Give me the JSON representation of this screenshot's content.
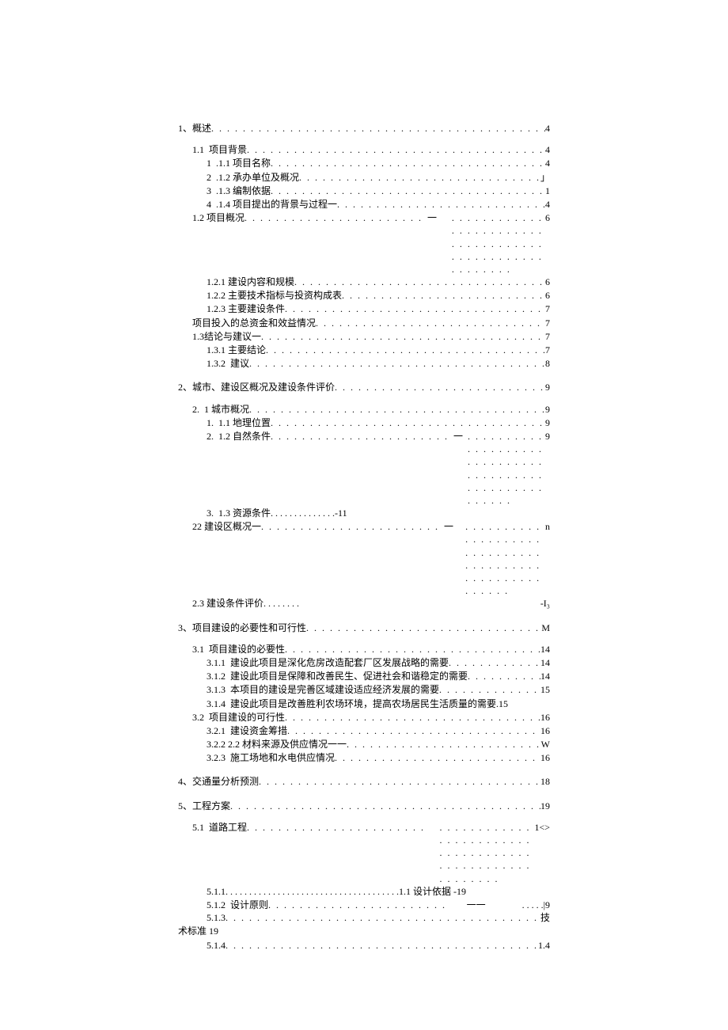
{
  "toc": {
    "c1": {
      "num": "1、",
      "title": "概述",
      "page": "4",
      "s11": {
        "num": "1.1",
        "title": "项目背景",
        "page": "4"
      },
      "s111": {
        "num": "1",
        "title": ".1.1 项目名称",
        "page": "4"
      },
      "s112": {
        "num": "2",
        "title": ".1.2 承办单位及概况",
        "page": "」"
      },
      "s113": {
        "num": "3",
        "title": ".1.3 编制依据",
        "page": "1"
      },
      "s114": {
        "num": "4",
        "title": ".1.4 项目提出的背景与过程一",
        "page": "4"
      },
      "s12": {
        "num": "1.2",
        "title": "项目概况",
        "mid": "一",
        "page": "6"
      },
      "s121": {
        "num": "1.2.1",
        "title": "建设内容和规模",
        "page": "6"
      },
      "s122": {
        "num": "1.2.2",
        "title": "主要技术指标与投资构成表",
        "page": "6"
      },
      "s123": {
        "num": "1.2.3",
        "title": "主要建设条件",
        "page": "7"
      },
      "sInvest": {
        "title": "项目投入的总资金和效益情况",
        "page": "7"
      },
      "s13": {
        "num": "1.3",
        "title": "结论与建议一",
        "page": "7"
      },
      "s131": {
        "num": "1.3.1",
        "title": "主要结论",
        "page": "7"
      },
      "s132": {
        "num": "1.3.2",
        "title": "建议",
        "page": "8"
      }
    },
    "c2": {
      "num": "2、",
      "title": "城市、建设区概况及建设条件评价",
      "page": "9",
      "s21": {
        "num": "2.",
        "title": "1 城市概况",
        "page": "9"
      },
      "s211": {
        "num": "1.",
        "title": "1.1 地理位置",
        "page": "9"
      },
      "s212": {
        "num": "2.",
        "title": "1.2 自然条件",
        "mid": "一",
        "page": "9"
      },
      "s213": {
        "num": "3.",
        "title": "1.3 资源条件",
        "page": "-11"
      },
      "s22": {
        "title": "22 建设区概况一",
        "mid": "一",
        "page": "n"
      },
      "s23": {
        "title": "2.3 建设条件评价",
        "page": "-I₃"
      }
    },
    "c3": {
      "num": "3、",
      "title": "项目建设的必要性和可行性",
      "page": "M",
      "s31": {
        "num": "3.1",
        "title": "项目建设的必要性",
        "page": "14"
      },
      "s311": {
        "num": "3.1.1",
        "title": "建设此项目是深化危房改造配套厂区发展战略的需要",
        "page": "14"
      },
      "s312": {
        "num": "3.1.2",
        "title": "建设此项目是保障和改善民生、促进社会和谐稳定的需要",
        "page": "14"
      },
      "s313": {
        "num": "3.1.3",
        "title": "本项目的建设是完善区域建设适应经济发展的需要",
        "page": "15"
      },
      "s314": {
        "num": "3.1.4",
        "title": "建设此项目是改善胜利农场环境，提高农场居民生活质量的需要",
        "page": "15"
      },
      "s32": {
        "num": "3.2",
        "title": "项目建设的可行性",
        "page": "16"
      },
      "s321": {
        "num": "3.2.1",
        "title": "建设资金筹措",
        "page": "16"
      },
      "s322": {
        "num": "3.2.2 2.2 材料来源及供应情况一一",
        "title": "",
        "page": "W"
      },
      "s323": {
        "num": "3.2.3",
        "title": "施工场地和水电供应情况",
        "page": "16"
      }
    },
    "c4": {
      "num": "4、",
      "title": "交通量分析预测",
      "page": "18"
    },
    "c5": {
      "num": "5、",
      "title": "工程方案",
      "page": "19",
      "s51": {
        "num": "5.1",
        "title": "道路工程",
        "page": "1<>"
      },
      "s511": {
        "num": "5.1.1",
        "title": "",
        "tail": "1.1 设计依据  -19"
      },
      "s512": {
        "num": "5.1.2",
        "title": "设计原则",
        "mid": "一一",
        "page": "|9"
      },
      "s513": {
        "num": "5.1.3",
        "title": "",
        "page": "技"
      },
      "s513b": {
        "title": "术标准   19"
      },
      "s514": {
        "num": "5.1.4",
        "title": "",
        "page": "1.4"
      }
    }
  }
}
